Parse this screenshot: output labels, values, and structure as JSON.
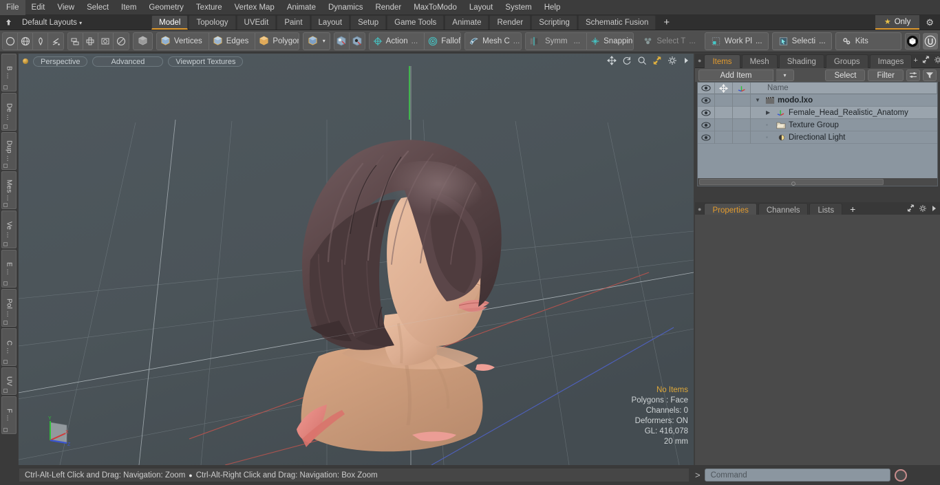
{
  "menubar": {
    "items": [
      "File",
      "Edit",
      "View",
      "Select",
      "Item",
      "Geometry",
      "Texture",
      "Vertex Map",
      "Animate",
      "Dynamics",
      "Render",
      "MaxToModo",
      "Layout",
      "System",
      "Help"
    ]
  },
  "layoutbar": {
    "home_icon": "home-arrow-icon",
    "layout_label": "Default Layouts",
    "layout_caret": "▾",
    "tabs": [
      {
        "label": "Model",
        "active": true
      },
      {
        "label": "Topology",
        "active": false
      },
      {
        "label": "UVEdit",
        "active": false
      },
      {
        "label": "Paint",
        "active": false
      },
      {
        "label": "Layout",
        "active": false
      },
      {
        "label": "Setup",
        "active": false
      },
      {
        "label": "Game Tools",
        "active": false
      },
      {
        "label": "Animate",
        "active": false
      },
      {
        "label": "Render",
        "active": false
      },
      {
        "label": "Scripting",
        "active": false
      },
      {
        "label": "Schematic Fusion",
        "active": false
      }
    ],
    "add_tab": "+",
    "only_label": "Only",
    "only_star": "★",
    "gear": "⚙",
    "accent_color": "#e09a2b"
  },
  "toolbar": {
    "group1": [
      "circle-icon",
      "globe-icon",
      "pen-icon",
      "lasso-icon"
    ],
    "group2": [
      "flatten-icon",
      "center-icon",
      "boundary-icon",
      "ellipse-icon"
    ],
    "solo_cube": "cube-grey-icon",
    "selection_modes": [
      {
        "label": "Vertices",
        "icon": "cube-vertices-icon"
      },
      {
        "label": "Edges",
        "icon": "cube-edges-icon"
      },
      {
        "label": "Polygons",
        "icon": "cube-polygons-icon"
      }
    ],
    "mode_caret": "▾",
    "snap_toggles": [
      "snap-a-icon",
      "snap-b-icon"
    ],
    "tools": [
      {
        "label": "Action",
        "suffix": "...",
        "icon": "action-center-icon"
      },
      {
        "label": "Falloff",
        "suffix": "",
        "icon": "falloff-icon"
      },
      {
        "label": "Mesh C",
        "suffix": "...",
        "icon": "mesh-constraint-icon"
      },
      {
        "label": "Symm",
        "suffix": "...",
        "icon": "symmetry-icon"
      },
      {
        "label": "Snapping",
        "suffix": "",
        "icon": "snapping-icon"
      },
      {
        "label": "Select T",
        "suffix": "...",
        "icon": "select-through-icon",
        "dim": true
      },
      {
        "label": "Work Pl",
        "suffix": "...",
        "icon": "work-plane-icon"
      },
      {
        "label": "Selecti",
        "suffix": "...",
        "icon": "selection-set-icon"
      },
      {
        "label": "Kits",
        "suffix": "",
        "icon": "kits-gears-icon"
      }
    ],
    "right_icons": [
      "unity-icon",
      "unreal-icon"
    ]
  },
  "left_tabs": [
    "B ...",
    "De ...",
    "Dup ...",
    "Mes ...",
    "Ve ...",
    "E ...",
    "Pol ...",
    "C ...",
    "UV",
    "F ..."
  ],
  "viewport": {
    "pills": [
      "Perspective",
      "Advanced",
      "Viewport Textures"
    ],
    "header_icons": [
      "move-icon",
      "rotate-icon",
      "zoom-icon",
      "fullscreen-icon",
      "gear-icon",
      "chevron-right-icon"
    ],
    "stats": {
      "no_items": "No Items",
      "polygons": "Polygons : Face",
      "channels": "Channels: 0",
      "deformers": "Deformers: ON",
      "gl": "GL: 416,078",
      "scale": "20 mm"
    },
    "gizmo": {
      "x": "X",
      "y": "Y",
      "z": "Z"
    },
    "bg_color": "#4d565c",
    "model": "female-head-realistic-anatomy-3d-model"
  },
  "right_panel": {
    "top_tabs": [
      {
        "label": "Items",
        "active": true
      },
      {
        "label": "Mesh ...",
        "active": false
      },
      {
        "label": "Shading",
        "active": false
      },
      {
        "label": "Groups",
        "active": false
      },
      {
        "label": "Images",
        "active": false
      }
    ],
    "top_tabs_right": [
      "add-icon",
      "expand-icon",
      "gear-icon",
      "chevron-right-icon"
    ],
    "add_item_label": "Add Item",
    "add_item_caret": "▾",
    "select_label": "Select",
    "filter_label": "Filter",
    "list_icon_buttons": [
      "list-options-icon",
      "filter-funnel-icon"
    ],
    "list_headers": {
      "eye": "visibility-icon",
      "lock": "move-icon",
      "axis": "axis-icon",
      "name": "Name"
    },
    "items": [
      {
        "name": "modo.lxo",
        "icon": "scene-clapper-icon",
        "depth": 0,
        "expanded": true,
        "selected": false
      },
      {
        "name": "Female_Head_Realistic_Anatomy",
        "icon": "mesh-axis-icon",
        "depth": 1,
        "expanded": false,
        "selected": true
      },
      {
        "name": "Texture Group",
        "icon": "folder-texture-icon",
        "depth": 1,
        "expanded": null,
        "selected": false
      },
      {
        "name": "Directional Light",
        "icon": "light-icon",
        "depth": 1,
        "expanded": null,
        "selected": false
      }
    ],
    "bottom_tabs": [
      {
        "label": "Properties",
        "active": true
      },
      {
        "label": "Channels",
        "active": false
      },
      {
        "label": "Lists",
        "active": false
      }
    ],
    "bottom_add_tab": "+",
    "bottom_tabs_right": [
      "expand-icon",
      "gear-icon",
      "chevron-right-icon"
    ]
  },
  "statusbar": {
    "left_hint": "Ctrl-Alt-Left Click and Drag: Navigation: Zoom",
    "bullet": "●",
    "right_hint": "Ctrl-Alt-Right Click and Drag: Navigation: Box Zoom",
    "command_prompt": ">",
    "command_placeholder": "Command",
    "record_icon": "record-circle-icon"
  }
}
